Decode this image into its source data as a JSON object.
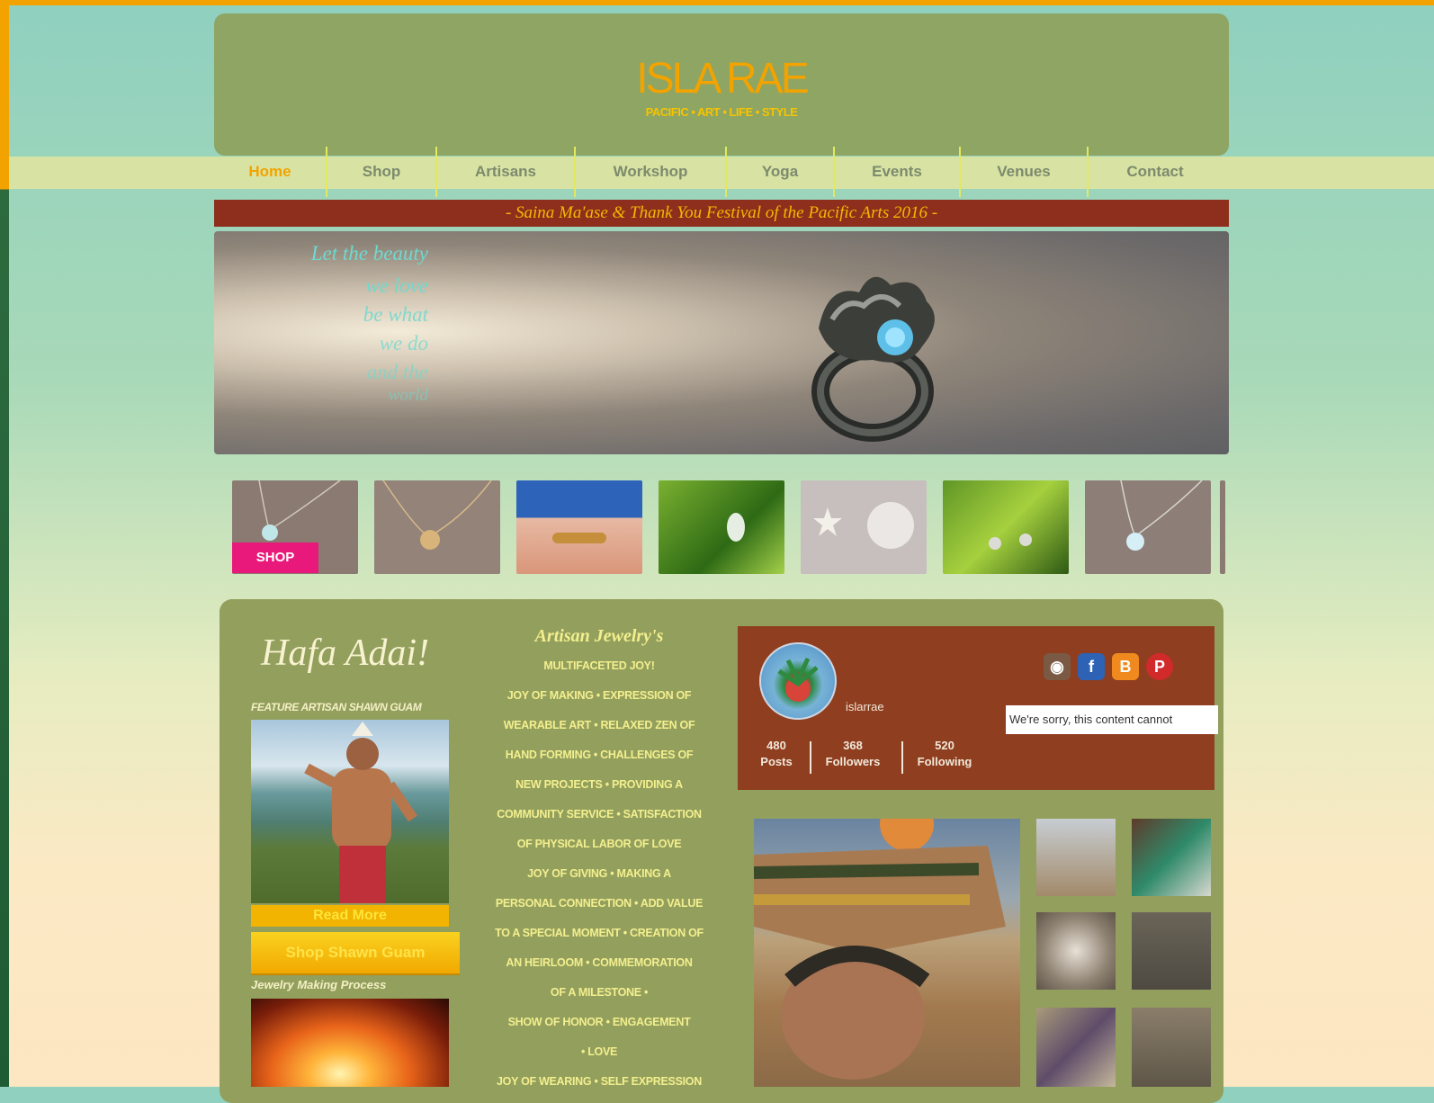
{
  "site": {
    "logo": "ISLA RAE",
    "tagline": "PACIFIC • ART • LIFE • STYLE"
  },
  "nav": {
    "items": [
      "Home",
      "Shop",
      "Artisans",
      "Workshop",
      "Yoga",
      "Events",
      "Venues",
      "Contact"
    ],
    "active": "Home"
  },
  "banner": {
    "text": "- Saina Ma'ase & Thank You Festival of the Pacific Arts 2016 -"
  },
  "hero": {
    "poem": [
      "Let the beauty",
      "we love",
      "be what",
      "we do",
      "and the",
      "world"
    ]
  },
  "thumbs": {
    "shop_label": "SHOP"
  },
  "left_col": {
    "greeting": "Hafa Adai!",
    "feature_label": "FEATURE ARTISAN SHAWN GUAM",
    "read_more": "Read More",
    "shop_button": "Shop Shawn Guam",
    "process_label": "Jewelry Making Process"
  },
  "middle_col": {
    "title": "Artisan Jewelry's",
    "lines": [
      "MULTIFACETED JOY!",
      "JOY OF MAKING • EXPRESSION OF",
      "WEARABLE ART • RELAXED ZEN OF",
      "HAND FORMING • CHALLENGES OF",
      "NEW PROJECTS • PROVIDING A",
      "COMMUNITY SERVICE • SATISFACTION",
      "OF PHYSICAL LABOR OF LOVE",
      "JOY OF GIVING • MAKING A",
      "PERSONAL CONNECTION • ADD VALUE",
      "TO A SPECIAL MOMENT • CREATION OF",
      "AN HEIRLOOM • COMMEMORATION",
      "OF A MILESTONE •",
      "SHOW OF HONOR • ENGAGEMENT",
      "• LOVE",
      "JOY OF WEARING • SELF EXPRESSION"
    ]
  },
  "instagram": {
    "username": "islarrae",
    "posts": "480",
    "posts_label": "Posts",
    "followers": "368",
    "followers_label": "Followers",
    "following": "520",
    "following_label": "Following",
    "notice": "We're sorry, this content cannot"
  },
  "social_icons": [
    "instagram-icon",
    "facebook-icon",
    "blogger-icon",
    "pinterest-icon"
  ],
  "colors": {
    "accent": "#f2a300",
    "banner_bg": "#8e2f1d",
    "header_bg": "#8ea564",
    "panel_bg": "#8f3e1f",
    "shop_tag": "#e8197a"
  }
}
